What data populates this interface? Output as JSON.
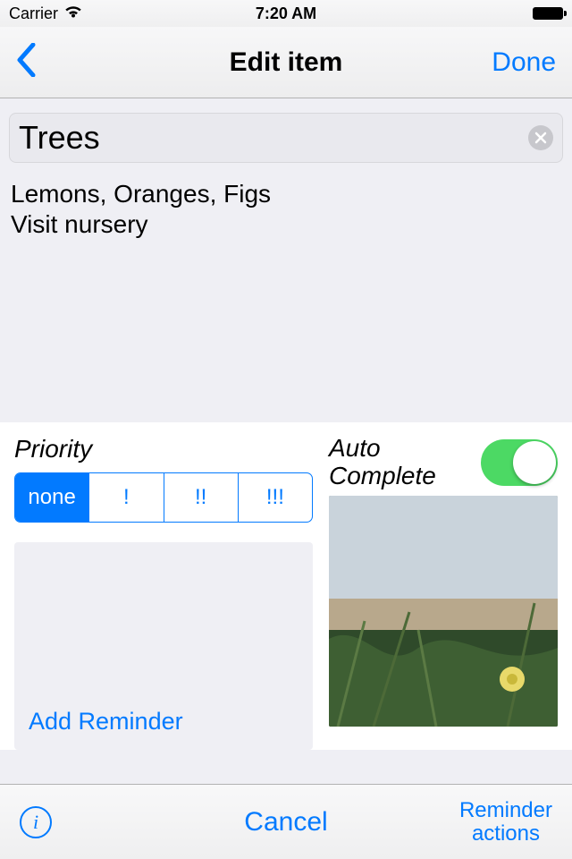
{
  "status": {
    "carrier": "Carrier",
    "time": "7:20 AM"
  },
  "nav": {
    "title": "Edit item",
    "done": "Done"
  },
  "item": {
    "title": "Trees",
    "notes": "Lemons, Oranges, Figs\nVisit nursery"
  },
  "priority": {
    "label": "Priority",
    "options": [
      "none",
      "!",
      "!!",
      "!!!"
    ],
    "selected": 0
  },
  "reminder": {
    "add": "Add Reminder"
  },
  "autocomplete": {
    "label_line1": "Auto",
    "label_line2": "Complete",
    "on": true
  },
  "toolbar": {
    "cancel": "Cancel",
    "reminder_actions_line1": "Reminder",
    "reminder_actions_line2": "actions"
  }
}
